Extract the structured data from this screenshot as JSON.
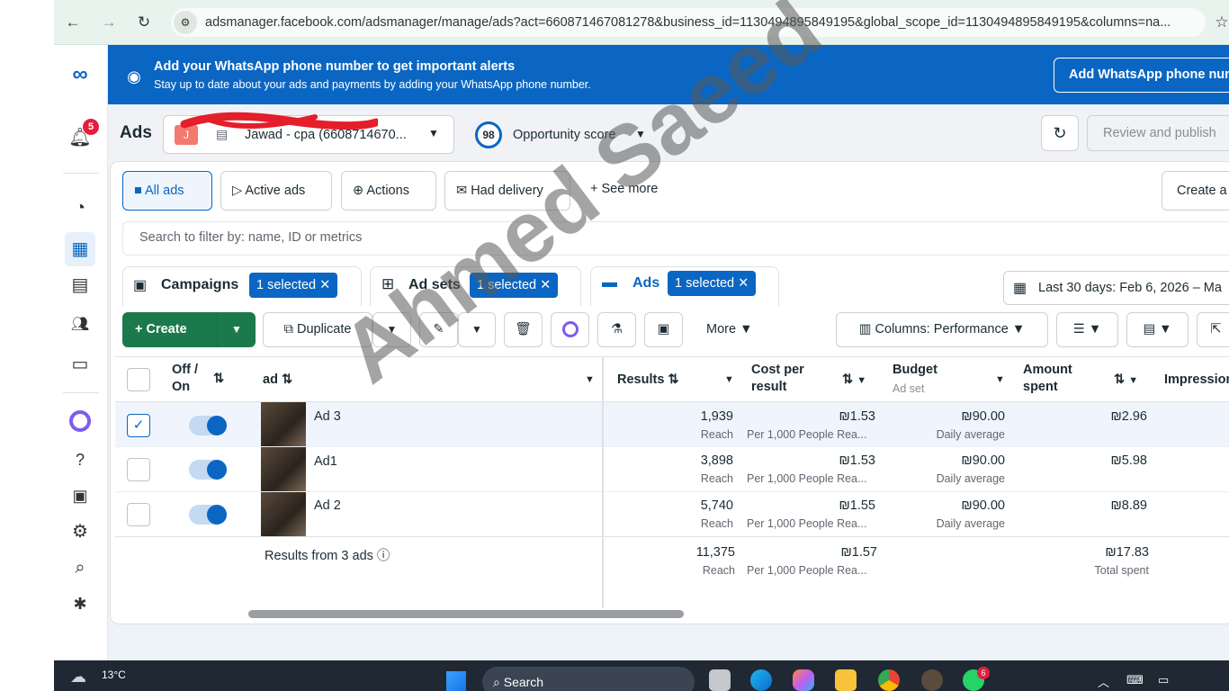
{
  "browser": {
    "url": "adsmanager.facebook.com/adsmanager/manage/ads?act=660871467081278&business_id=1130494895849195&global_scope_id=1130494895849195&columns=na..."
  },
  "banner": {
    "title": "Add your WhatsApp phone number to get important alerts",
    "subtitle": "Stay up to date about your ads and payments by adding your WhatsApp phone number.",
    "button": "Add WhatsApp phone num"
  },
  "rail": {
    "notification_count": "5"
  },
  "header": {
    "title": "Ads",
    "account_avatar": "J",
    "account_name": "Jawad - cpa (6608714670...",
    "opportunity_score": "98",
    "opportunity_label": "Opportunity score",
    "review_publish": "Review and publish"
  },
  "filters": {
    "tabs": [
      "All ads",
      "Active ads",
      "Actions",
      "Had delivery"
    ],
    "see_more": "See more",
    "create_a": "Create a",
    "search_placeholder": "Search to filter by: name, ID or metrics"
  },
  "levels": {
    "campaigns": "Campaigns",
    "campaigns_chip": "1 selected",
    "adsets": "Ad sets",
    "adsets_chip": "1 selected",
    "ads": "Ads",
    "ads_chip": "1 selected",
    "date_range": "Last 30 days: Feb 6, 2026 – Ma"
  },
  "toolbar": {
    "create": "Create",
    "duplicate": "Duplicate",
    "more": "More",
    "columns": "Columns: Performance"
  },
  "table": {
    "headers": {
      "off_on": "Off / On",
      "ad": "ad",
      "results": "Results",
      "cost_per_result": "Cost per result",
      "budget": "Budget",
      "budget_sub": "Ad set",
      "amount_spent": "Amount spent",
      "impressions": "Impression"
    },
    "rows": [
      {
        "name": "Ad 3",
        "results": "1,939",
        "results_sub": "Reach",
        "cpr": "₪1.53",
        "cpr_sub": "Per 1,000 People Rea...",
        "budget": "₪90.00",
        "budget_sub": "Daily average",
        "spent": "₪2.96"
      },
      {
        "name": "Ad1",
        "results": "3,898",
        "results_sub": "Reach",
        "cpr": "₪1.53",
        "cpr_sub": "Per 1,000 People Rea...",
        "budget": "₪90.00",
        "budget_sub": "Daily average",
        "spent": "₪5.98"
      },
      {
        "name": "Ad 2",
        "results": "5,740",
        "results_sub": "Reach",
        "cpr": "₪1.55",
        "cpr_sub": "Per 1,000 People Rea...",
        "budget": "₪90.00",
        "budget_sub": "Daily average",
        "spent": "₪8.89"
      }
    ],
    "summary": {
      "label": "Results from 3 ads",
      "results": "11,375",
      "results_sub": "Reach",
      "cpr": "₪1.57",
      "cpr_sub": "Per 1,000 People Rea...",
      "spent": "₪17.83",
      "spent_sub": "Total spent"
    }
  },
  "watermark": "Ahmed Saeed",
  "taskbar": {
    "temp": "13°C",
    "search": "Search",
    "whatsapp_badge": "6"
  }
}
